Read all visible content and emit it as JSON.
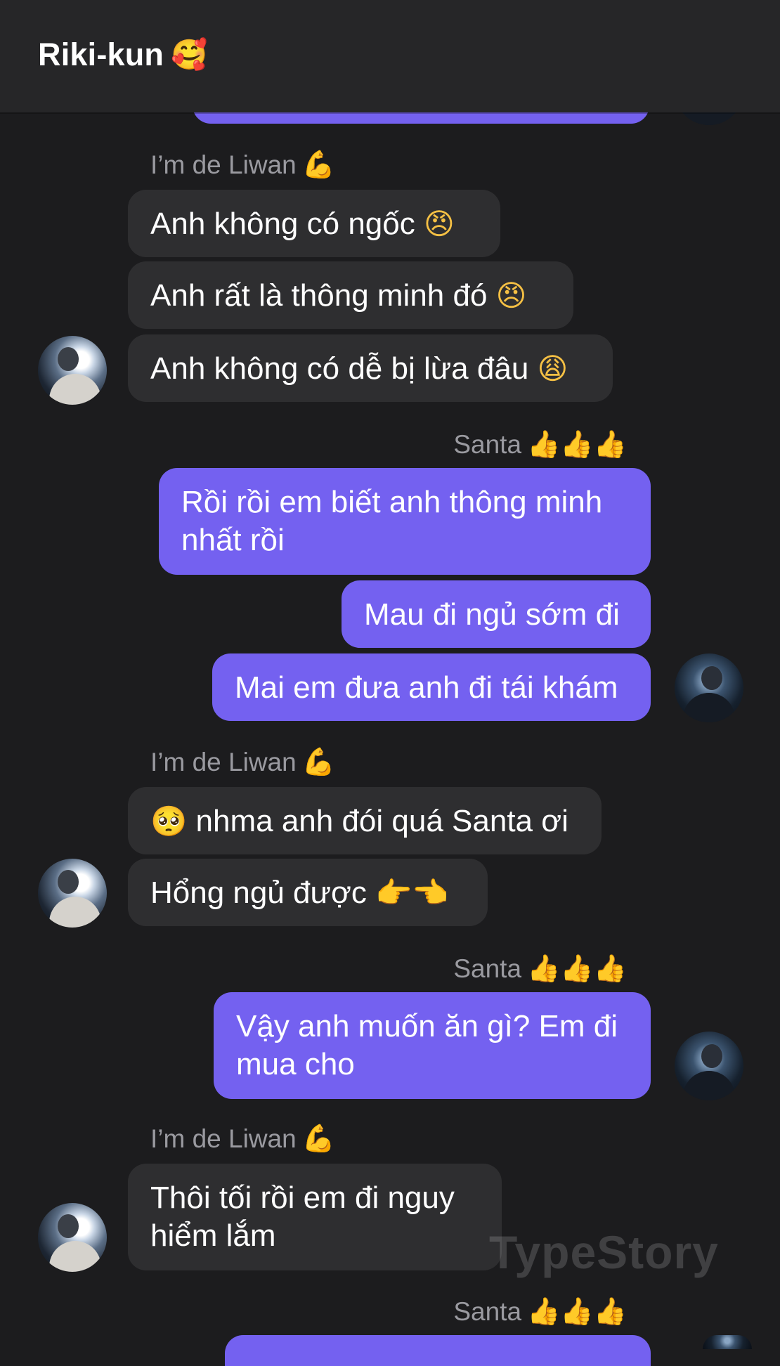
{
  "header": {
    "title": "Riki-kun",
    "title_emoji": "🥰"
  },
  "senders": {
    "liwan": {
      "name": "I’m de Liwan",
      "emoji": "💪"
    },
    "santa": {
      "name": "Santa",
      "emoji": "👍👍👍"
    }
  },
  "messages": {
    "m1": {
      "text": "Anh không có ngốc",
      "emoji": "😠"
    },
    "m2": {
      "text": "Anh rất là thông minh đó",
      "emoji": "😠"
    },
    "m3": {
      "text": "Anh không có dễ bị lừa đâu",
      "emoji": "😩"
    },
    "m4": {
      "line1": "Rồi rồi em biết anh thông minh",
      "line2": "nhất rồi"
    },
    "m5": {
      "text": "Mau đi ngủ sớm đi"
    },
    "m6": {
      "text": "Mai em đưa anh đi tái khám"
    },
    "m7": {
      "emoji": "🥺",
      "text": "nhma anh đói quá Santa ơi"
    },
    "m8": {
      "text": "Hổng ngủ được",
      "emoji": "👉👈"
    },
    "m9": {
      "line1": "Vậy anh muốn ăn gì? Em đi",
      "line2": "mua cho"
    },
    "m10": {
      "line1": "Thôi tối rồi em đi nguy",
      "line2": "hiểm lắm"
    }
  },
  "watermark": "TypeStory",
  "colors": {
    "background": "#1c1c1e",
    "header": "#262628",
    "incoming": "#2e2e30",
    "outgoing": "#7461f0"
  }
}
